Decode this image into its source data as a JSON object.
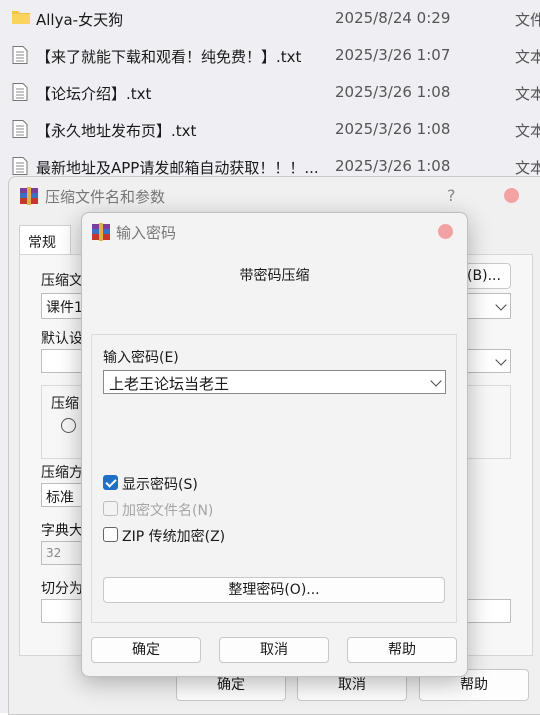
{
  "explorer": {
    "rows": [
      {
        "icon": "folder-icon",
        "name": "Allya-女天狗",
        "date": "2025/8/24 0:29",
        "type": "文件"
      },
      {
        "icon": "text-file-icon",
        "name": "【来了就能下载和观看！纯免费！】.txt",
        "date": "2025/3/26 1:07",
        "type": "文本"
      },
      {
        "icon": "text-file-icon",
        "name": "【论坛介绍】.txt",
        "date": "2025/3/26 1:08",
        "type": "文本"
      },
      {
        "icon": "text-file-icon",
        "name": "【永久地址发布页】.txt",
        "date": "2025/3/26 1:08",
        "type": "文本"
      },
      {
        "icon": "text-file-icon",
        "name": "最新地址及APP请发邮箱自动获取！！！...",
        "date": "2025/3/26 1:08",
        "type": "文本"
      }
    ]
  },
  "archive_dialog": {
    "title": "压缩文件名和参数",
    "help": "?",
    "tab_general": "常规",
    "archive_name_label": "压缩文",
    "archive_name_value": "课件1",
    "browse_button": "(B)...",
    "default_label": "默认设",
    "format_group_label": "压缩",
    "method_label": "压缩方",
    "method_value": "标准",
    "dict_label": "字典大",
    "dict_value": "32",
    "split_label": "切分为",
    "ok": "确定",
    "cancel": "取消",
    "help_button": "帮助",
    "accent_close": "#f2a2a2"
  },
  "password_dialog": {
    "title": "输入密码",
    "heading": "带密码压缩",
    "password_label": "输入密码(E)",
    "password_value": "上老王论坛当老王",
    "show_password": {
      "label": "显示密码(S)",
      "checked": true
    },
    "encrypt_names": {
      "label": "加密文件名(N)",
      "checked": false,
      "disabled": true
    },
    "zip_legacy": {
      "label": "ZIP 传统加密(Z)",
      "checked": false
    },
    "organize_button": "整理密码(O)...",
    "ok": "确定",
    "cancel": "取消",
    "help_button": "帮助",
    "accent": "#1f6fc7"
  }
}
